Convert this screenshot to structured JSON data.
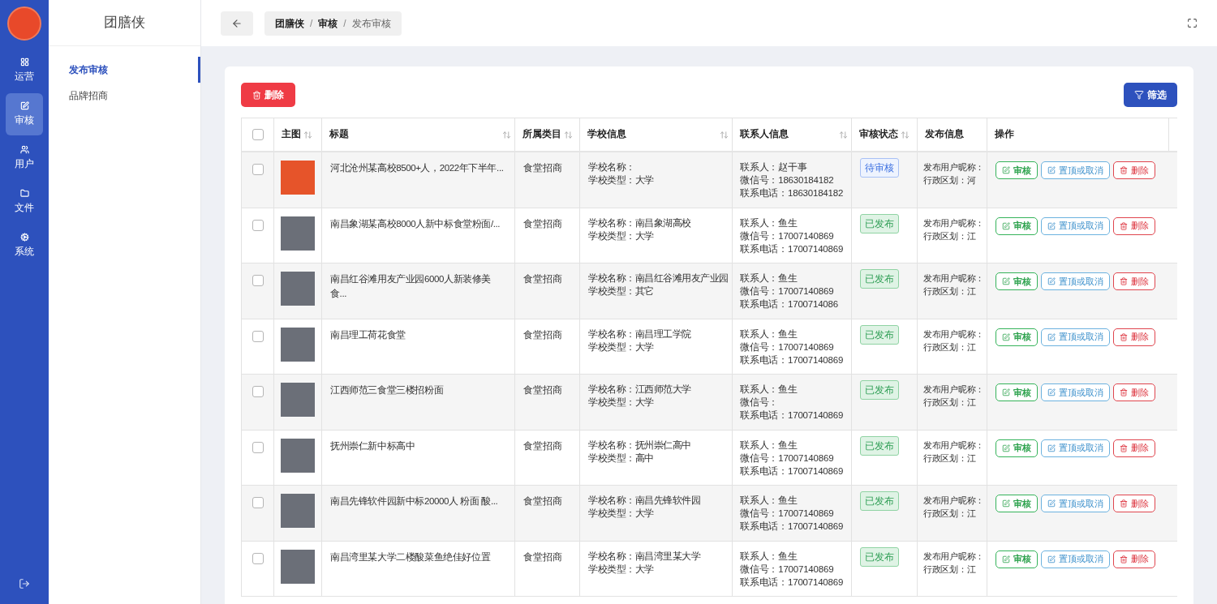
{
  "nav_rail": {
    "items": [
      {
        "label": "运营",
        "selected": false
      },
      {
        "label": "审核",
        "selected": true
      },
      {
        "label": "用户",
        "selected": false
      },
      {
        "label": "文件",
        "selected": false
      },
      {
        "label": "系统",
        "selected": false
      }
    ]
  },
  "sidebar": {
    "title": "团膳侠",
    "items": [
      {
        "label": "发布审核",
        "selected": true
      },
      {
        "label": "品牌招商",
        "selected": false
      }
    ]
  },
  "breadcrumb": [
    {
      "label": "团膳侠",
      "current": false
    },
    {
      "separator": "/",
      "label": "审核",
      "current": false
    },
    {
      "separator": "/",
      "label": "发布审核",
      "current": true
    }
  ],
  "toolbar": {
    "delete_button": "删除",
    "filter_button": "筛选"
  },
  "table": {
    "select_all_checked": false,
    "columns": [
      {
        "label": "主图",
        "sortable": true
      },
      {
        "label": "标题",
        "sortable": true
      },
      {
        "label": "所属类目",
        "sortable": true
      },
      {
        "label": "学校信息",
        "sortable": true
      },
      {
        "label": "联系人信息",
        "sortable": true
      },
      {
        "label": "审核状态",
        "sortable": true
      },
      {
        "label": "发布信息",
        "sortable": false
      },
      {
        "label": "操作",
        "sortable": false
      }
    ],
    "rows": [
      {
        "checked": false,
        "kind": "logo",
        "title": "河北沧州某高校8500+人，2022年下半年...",
        "category": "食堂招商",
        "school": [
          "学校名称：",
          "学校类型：大学"
        ],
        "contact": [
          "联系人：赵干事",
          "微信号：18630184182",
          "联系电话：18630184182"
        ],
        "status": {
          "kind": "pending",
          "label": "待审核"
        },
        "publish": [
          "发布用户昵称：",
          "行政区划：河"
        ],
        "actions": [
          {
            "kind": "review",
            "label": "审核"
          },
          {
            "kind": "pin",
            "label": "置顶或取消"
          },
          {
            "kind": "delete",
            "label": "删除"
          }
        ]
      },
      {
        "checked": false,
        "kind": "photo",
        "title": "南昌象湖某高校8000人新中标食堂粉面/...",
        "category": "食堂招商",
        "school": [
          "学校名称：南昌象湖高校",
          "学校类型：大学"
        ],
        "contact": [
          "联系人：鱼生",
          "微信号：17007140869",
          "联系电话：17007140869"
        ],
        "status": {
          "kind": "published",
          "label": "已发布"
        },
        "publish": [
          "发布用户昵称：",
          "行政区划：江"
        ],
        "actions": [
          {
            "kind": "review",
            "label": "审核"
          },
          {
            "kind": "pin",
            "label": "置顶或取消"
          },
          {
            "kind": "delete",
            "label": "删除"
          }
        ]
      },
      {
        "checked": false,
        "kind": "photo",
        "title": "南昌红谷滩用友产业园6000人新装修美食...",
        "category": "食堂招商",
        "school": [
          "学校名称：南昌红谷滩用友产业园",
          "学校类型：其它"
        ],
        "contact": [
          "联系人：鱼生",
          "微信号：17007140869",
          "联系电话：1700714086"
        ],
        "status": {
          "kind": "published",
          "label": "已发布"
        },
        "publish": [
          "发布用户昵称：",
          "行政区划：江"
        ],
        "actions": [
          {
            "kind": "review",
            "label": "审核"
          },
          {
            "kind": "pin",
            "label": "置顶或取消"
          },
          {
            "kind": "delete",
            "label": "删除"
          }
        ]
      },
      {
        "checked": false,
        "kind": "photo",
        "title": "南昌理工荷花食堂",
        "category": "食堂招商",
        "school": [
          "学校名称：南昌理工学院",
          "学校类型：大学"
        ],
        "contact": [
          "联系人：鱼生",
          "微信号：17007140869",
          "联系电话：17007140869"
        ],
        "status": {
          "kind": "published",
          "label": "已发布"
        },
        "publish": [
          "发布用户昵称：",
          "行政区划：江"
        ],
        "actions": [
          {
            "kind": "review",
            "label": "审核"
          },
          {
            "kind": "pin",
            "label": "置顶或取消"
          },
          {
            "kind": "delete",
            "label": "删除"
          }
        ]
      },
      {
        "checked": false,
        "kind": "photo",
        "title": "江西师范三食堂三楼招粉面",
        "category": "食堂招商",
        "school": [
          "学校名称：江西师范大学",
          "学校类型：大学"
        ],
        "contact": [
          "联系人：鱼生",
          "微信号：",
          "联系电话：17007140869"
        ],
        "status": {
          "kind": "published",
          "label": "已发布"
        },
        "publish": [
          "发布用户昵称：",
          "行政区划：江"
        ],
        "actions": [
          {
            "kind": "review",
            "label": "审核"
          },
          {
            "kind": "pin",
            "label": "置顶或取消"
          },
          {
            "kind": "delete",
            "label": "删除"
          }
        ]
      },
      {
        "checked": false,
        "kind": "photo",
        "title": "抚州崇仁新中标高中",
        "category": "食堂招商",
        "school": [
          "学校名称：抚州崇仁高中",
          "学校类型：高中"
        ],
        "contact": [
          "联系人：鱼生",
          "微信号：17007140869",
          "联系电话：17007140869"
        ],
        "status": {
          "kind": "published",
          "label": "已发布"
        },
        "publish": [
          "发布用户昵称：",
          "行政区划：江"
        ],
        "actions": [
          {
            "kind": "review",
            "label": "审核"
          },
          {
            "kind": "pin",
            "label": "置顶或取消"
          },
          {
            "kind": "delete",
            "label": "删除"
          }
        ]
      },
      {
        "checked": false,
        "kind": "photo",
        "title": "南昌先锋软件园新中标20000人 粉面 酸...",
        "category": "食堂招商",
        "school": [
          "学校名称：南昌先锋软件园",
          "学校类型：大学"
        ],
        "contact": [
          "联系人：鱼生",
          "微信号：17007140869",
          "联系电话：17007140869"
        ],
        "status": {
          "kind": "published",
          "label": "已发布"
        },
        "publish": [
          "发布用户昵称：",
          "行政区划：江"
        ],
        "actions": [
          {
            "kind": "review",
            "label": "审核"
          },
          {
            "kind": "pin",
            "label": "置顶或取消"
          },
          {
            "kind": "delete",
            "label": "删除"
          }
        ]
      },
      {
        "checked": false,
        "kind": "photo",
        "title": "南昌湾里某大学二楼酸菜鱼绝佳好位置",
        "category": "食堂招商",
        "school": [
          "学校名称：南昌湾里某大学",
          "学校类型：大学"
        ],
        "contact": [
          "联系人：鱼生",
          "微信号：17007140869",
          "联系电话：17007140869"
        ],
        "status": {
          "kind": "published",
          "label": "已发布"
        },
        "publish": [
          "发布用户昵称：",
          "行政区划：江"
        ],
        "actions": [
          {
            "kind": "review",
            "label": "审核"
          },
          {
            "kind": "pin",
            "label": "置顶或取消"
          },
          {
            "kind": "delete",
            "label": "删除"
          }
        ]
      }
    ]
  }
}
